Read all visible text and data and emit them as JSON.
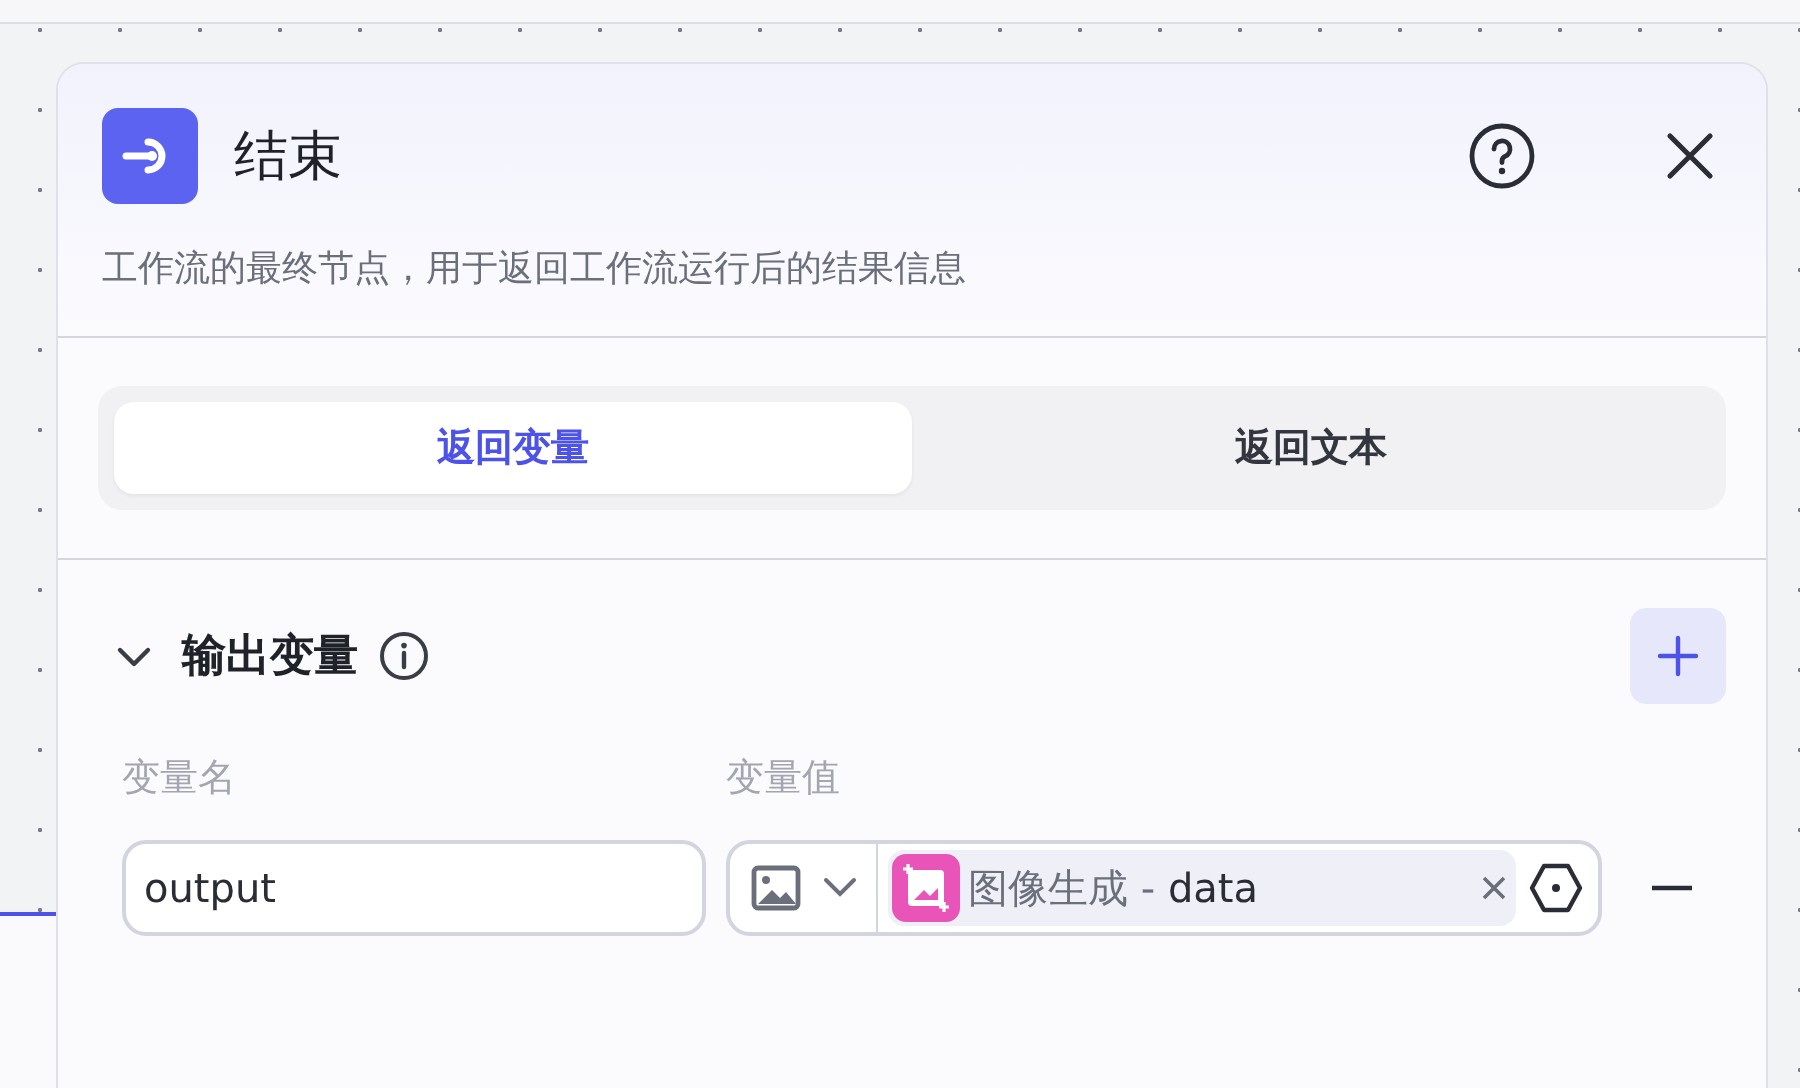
{
  "panel": {
    "title": "结束",
    "description": "工作流的最终节点，用于返回工作流运行后的结果信息"
  },
  "tabs": [
    {
      "label": "返回变量",
      "selected": true
    },
    {
      "label": "返回文本",
      "selected": false
    }
  ],
  "section": {
    "title": "输出变量",
    "expanded": true
  },
  "columns": [
    "变量名",
    "变量值"
  ],
  "variables": [
    {
      "name": "output",
      "source_node": "图像生成",
      "separator": "-",
      "source_field": "data"
    }
  ]
}
